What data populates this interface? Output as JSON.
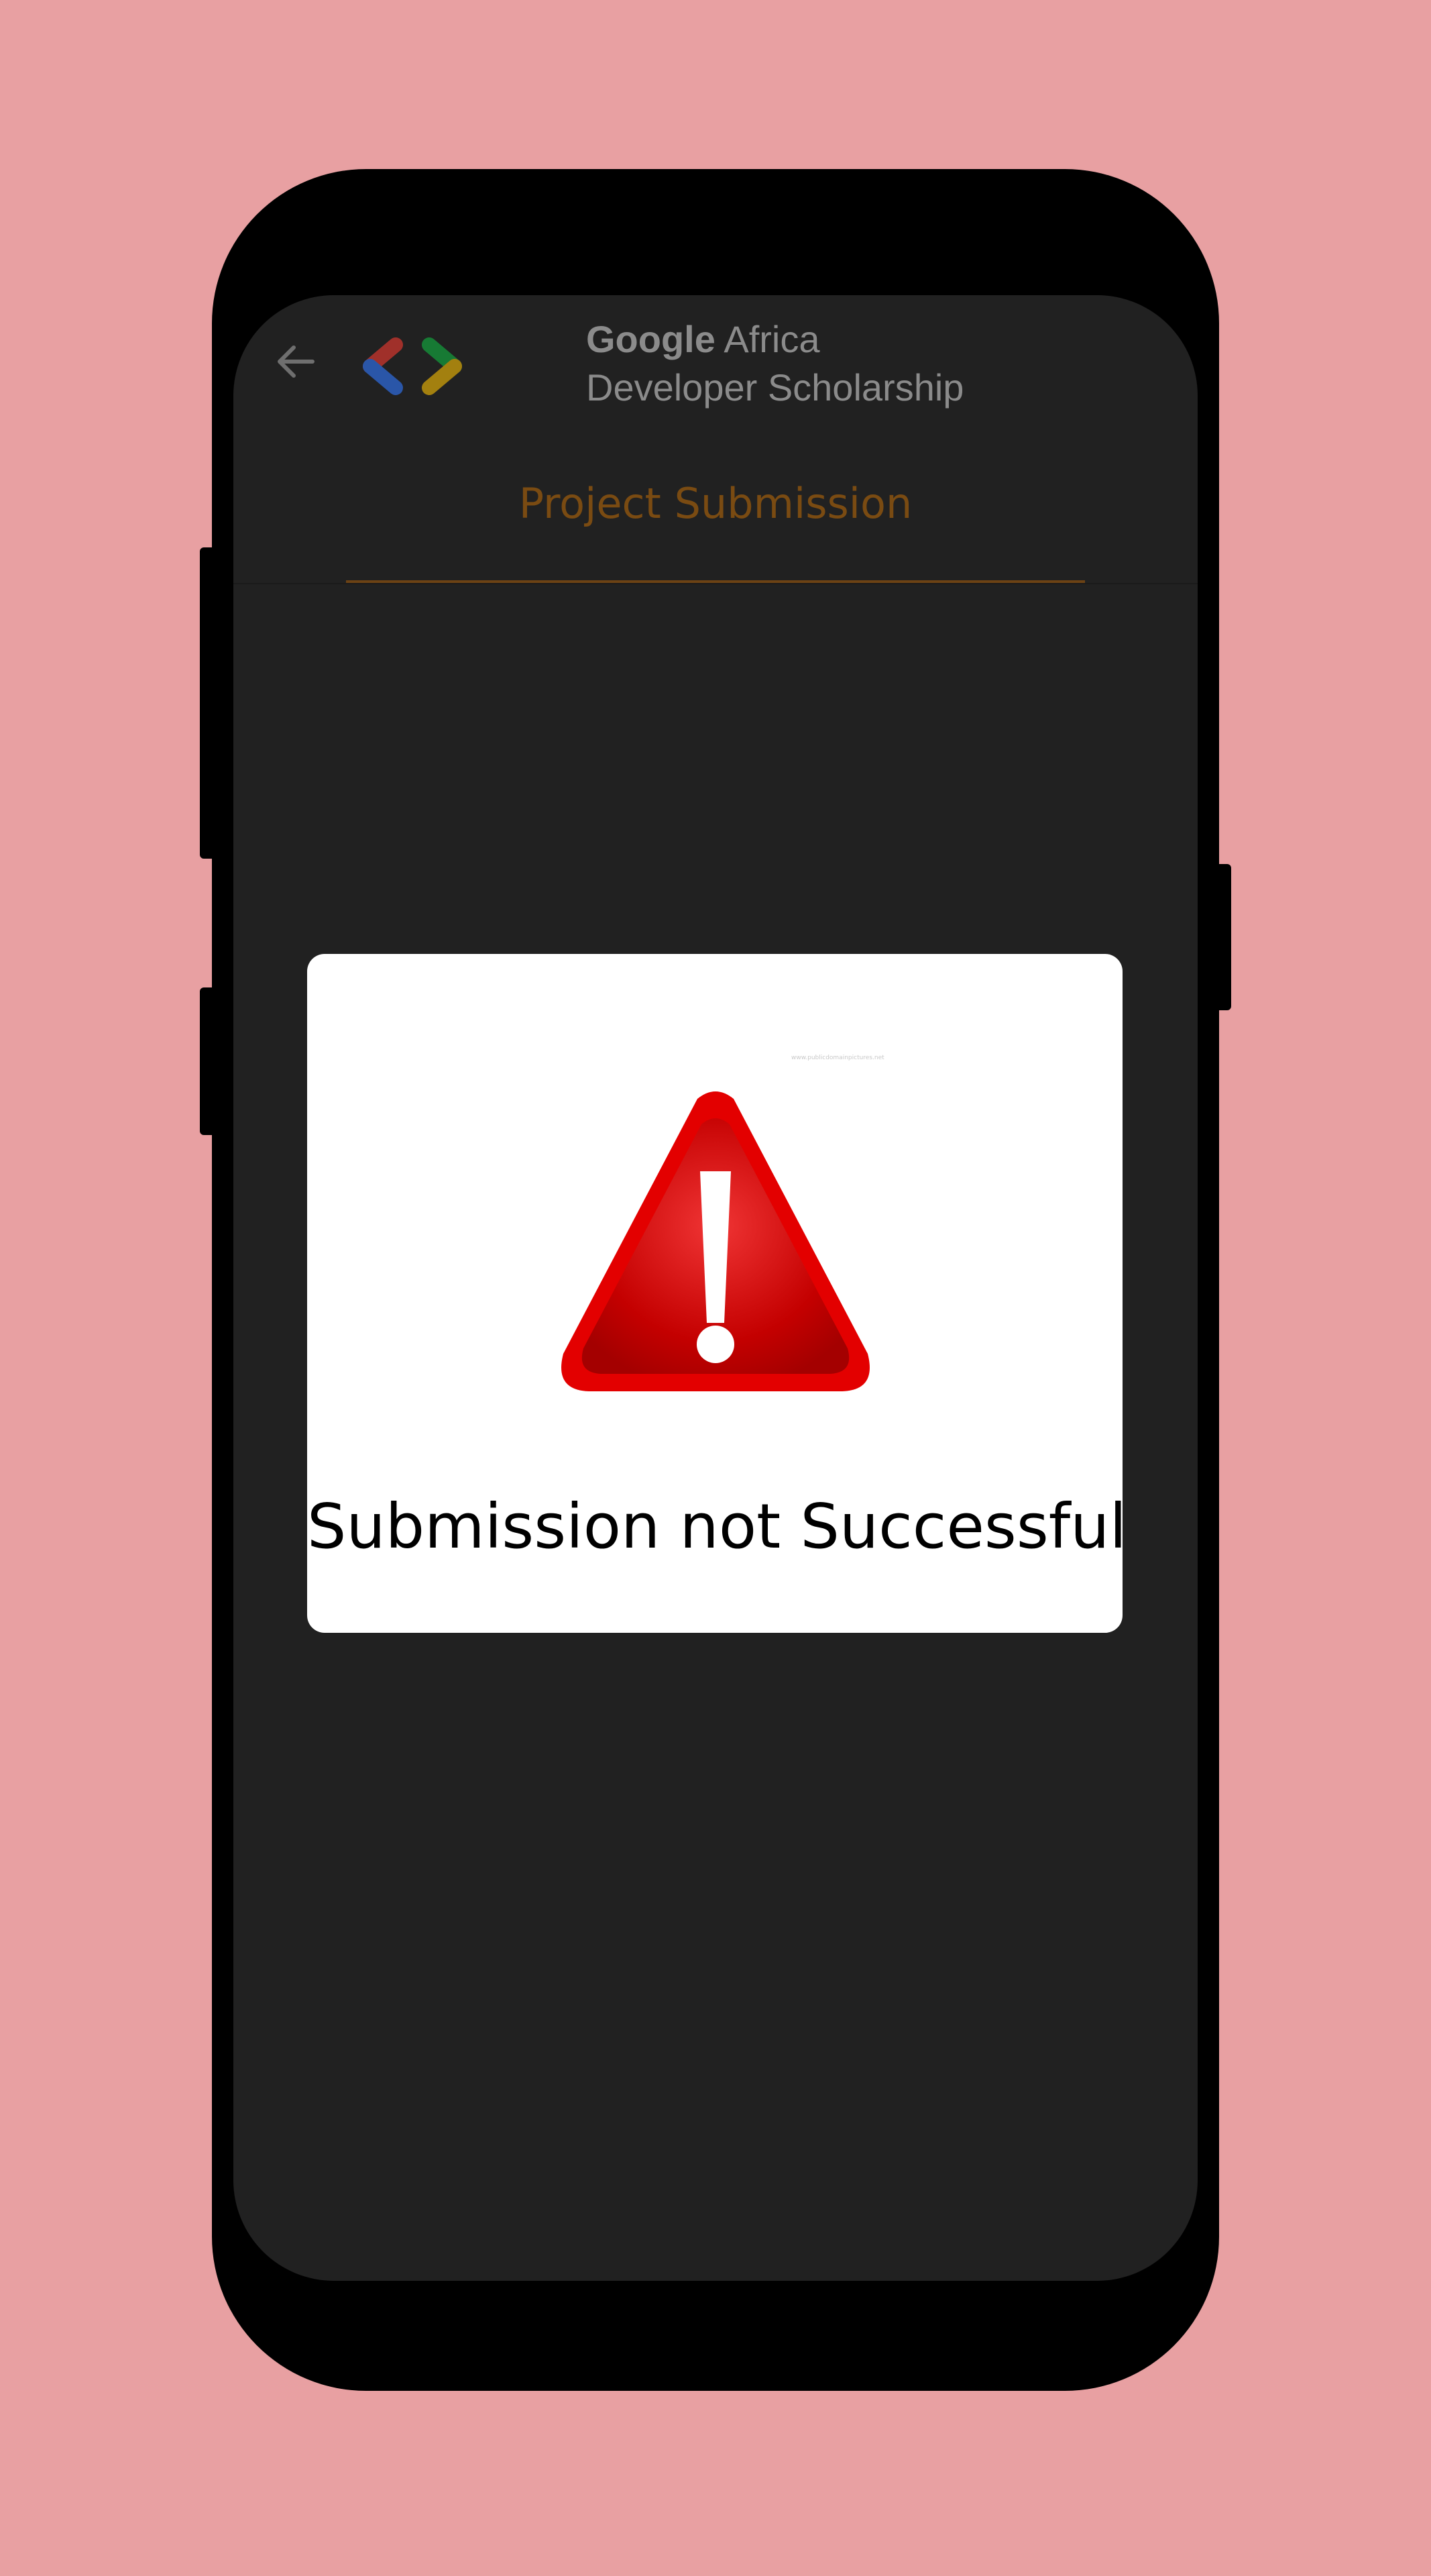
{
  "app": {
    "brand_line1_bold": "Google",
    "brand_line1_rest": " Africa",
    "brand_line2": "Developer Scholarship",
    "tab_title": "Project Submission"
  },
  "dialog": {
    "credit_text": "www.publicdomainpictures.net",
    "message": "Submission not Successful"
  },
  "icons": {
    "back": "arrow-back-icon",
    "logo": "gdg-logo",
    "warning": "warning-triangle-icon"
  },
  "colors": {
    "page_background": "#e8a0a2",
    "screen_background": "#212121",
    "accent": "#7a4b12",
    "warning_red": "#d10000",
    "logo_red": "#a0302a",
    "logo_blue": "#2a56a8",
    "logo_green": "#177a34",
    "logo_yellow": "#a3800f"
  }
}
